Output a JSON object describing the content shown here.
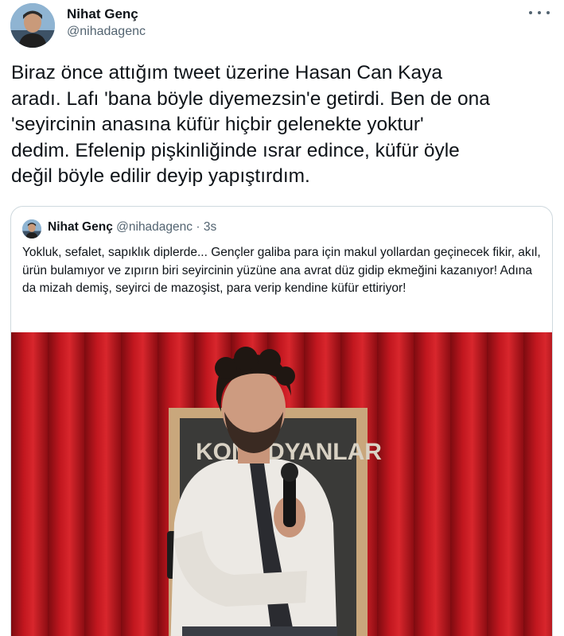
{
  "tweet": {
    "author": {
      "name": "Nihat Genç",
      "handle": "@nihadagenc",
      "avatar_icon": "profile-photo"
    },
    "more_icon": "more-horizontal-icon",
    "text": "Biraz önce attığım tweet üzerine Hasan Can Kaya\naradı. Lafı 'bana böyle diyemezsin'e getirdi. Ben de ona\n'seyircinin anasına küfür hiçbir gelenekte yoktur'\ndedim. Efelenip pişkinliğinde ısrar edince, küfür öyle\ndeğil böyle edilir deyip yapıştırdım."
  },
  "quote": {
    "author": {
      "name": "Nihat Genç",
      "handle": "@nihadagenc",
      "separator": "·",
      "time": "3s"
    },
    "text": "Yokluk, sefalet, sapıklık diplerde... Gençler galiba para için makul yollardan geçinecek fikir, akıl, ürün bulamıyor ve zıpırın biri seyircinin yüzüne ana avrat düz gidip ekmeğini kazanıyor! Adına da mizah demiş, seyirci de mazoşist, para verip kendine küfür ettiriyor!",
    "media": {
      "description_icon": "stage-photo",
      "sign_text": "KOMEDYANLAR"
    }
  },
  "colors": {
    "text_primary": "#0f1419",
    "text_secondary": "#536471",
    "border": "#cfd9de",
    "curtain": "#b3141b"
  }
}
